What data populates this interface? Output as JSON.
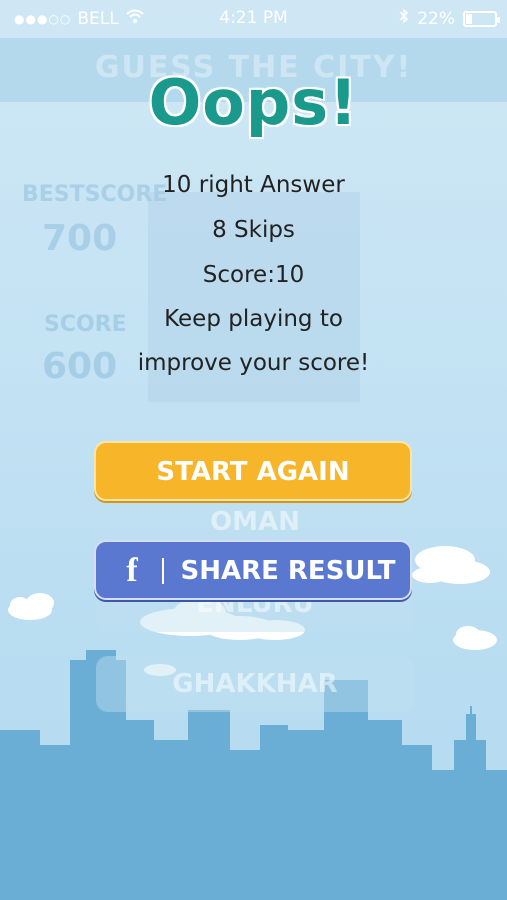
{
  "status_bar": {
    "carrier": "BELL",
    "signal_dots": "●●●○○",
    "time": "4:21 PM",
    "battery_text": "22%",
    "battery_level": 0.22
  },
  "background_game": {
    "title": "GUESS THE CITY!",
    "best_score_label": "BESTSCORE",
    "best_score_value": "700",
    "score_label": "SCORE",
    "score_value": "600",
    "options": [
      "OMAN",
      "ENLURU",
      "GHAKKHAR"
    ]
  },
  "popup": {
    "title": "Oops!",
    "right_answers": "10 right Answer",
    "skips": "8 Skips",
    "score": "Score:10",
    "message_line1": "Keep playing to",
    "message_line2": "improve your score!",
    "start_button": "START AGAIN",
    "share_button": "SHARE RESULT",
    "fb_glyph": "f"
  },
  "colors": {
    "title": "#1a9a8c",
    "start_button": "#f7b52a",
    "share_button": "#5a78cf",
    "skyline": "#6aaed6"
  },
  "icons": [
    "wifi-icon",
    "bluetooth-icon",
    "battery-icon",
    "facebook-icon"
  ]
}
